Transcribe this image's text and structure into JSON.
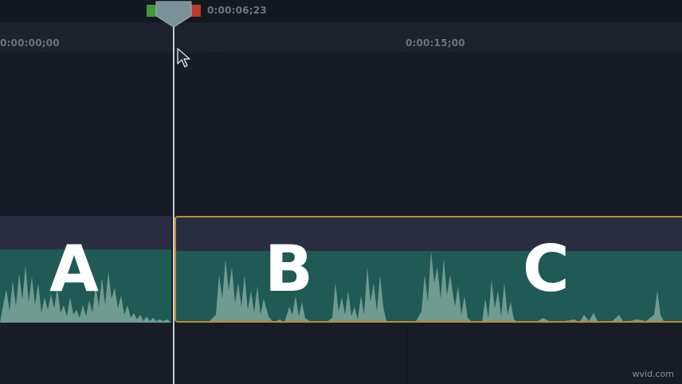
{
  "timeline": {
    "playhead_timecode": "0:00:06;23",
    "ruler_start": "0:00:00;00",
    "ruler_mid": "0:00:15;00"
  },
  "clips": {
    "a_label": "A",
    "b_label": "B",
    "c_label": "C"
  },
  "watermark": "wvid.com",
  "colors": {
    "background": "#181d27",
    "clip_bg": "#23283a",
    "waveform_bg": "#1f5a55",
    "waveform_peaks": "#7fa79c",
    "selection_border": "#c08a2c",
    "playhead": "#c7ccd3",
    "in_marker": "#3e9a3c",
    "out_marker": "#c0392b"
  },
  "icons": {
    "playhead": "playhead-handle-icon",
    "cursor": "mouse-pointer-icon"
  }
}
